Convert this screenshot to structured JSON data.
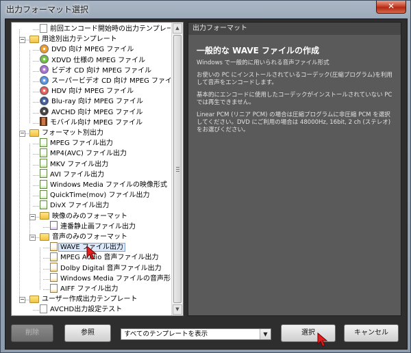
{
  "window": {
    "title": "出力フォーマット選択",
    "close_glyph": "✕"
  },
  "tree": {
    "items": [
      {
        "label": "前回エンコード開始時の出力テンプレート",
        "icon": "file-icon"
      },
      {
        "label": "用途別出力テンプレート",
        "icon": "folder-icon",
        "expander": "−"
      },
      {
        "label": "DVD 向け MPEG ファイル",
        "icon": "dvd-disc-icon"
      },
      {
        "label": "XDVD 仕様の MPEG ファイル",
        "icon": "xdvd-disc-icon"
      },
      {
        "label": "ビデオ CD 向け MPEG ファイル",
        "icon": "vcd-disc-icon"
      },
      {
        "label": "スーパービデオ CD 向け MPEG ファイル",
        "icon": "svcd-disc-icon"
      },
      {
        "label": "HDV 向け MPEG ファイル",
        "icon": "hdv-disc-icon"
      },
      {
        "label": "Blu-ray 向け MPEG ファイル",
        "icon": "bluray-disc-icon"
      },
      {
        "label": "AVCHD 向け MPEG ファイル",
        "icon": "avchd-disc-icon"
      },
      {
        "label": "モバイル向け MPEG ファイル",
        "icon": "mobile-icon"
      },
      {
        "label": "フォーマット別出力",
        "icon": "folder-icon",
        "expander": "−"
      },
      {
        "label": "MPEG ファイル出力",
        "icon": "video-file-icon"
      },
      {
        "label": "MP4(AVC) ファイル出力",
        "icon": "video-file-icon"
      },
      {
        "label": "MKV ファイル出力",
        "icon": "video-file-icon"
      },
      {
        "label": "AVI ファイル出力",
        "icon": "video-file-icon"
      },
      {
        "label": "Windows Media ファイルの映像形式",
        "icon": "video-file-icon"
      },
      {
        "label": "QuickTime(mov) ファイル出力",
        "icon": "video-file-icon"
      },
      {
        "label": "DivX ファイル出力",
        "icon": "video-file-icon"
      },
      {
        "label": "映像のみのフォーマット",
        "icon": "folder-icon",
        "expander": "−"
      },
      {
        "label": "連番静止画ファイル出力",
        "icon": "image-file-icon"
      },
      {
        "label": "音声のみのフォーマット",
        "icon": "folder-icon",
        "expander": "−"
      },
      {
        "label": "WAVE ファイル出力",
        "icon": "audio-file-icon",
        "selected": true
      },
      {
        "label": "MPEG Audio 音声ファイル出力",
        "icon": "audio-file-icon"
      },
      {
        "label": "Dolby Digital 音声ファイル出力",
        "icon": "audio-file-icon"
      },
      {
        "label": "Windows Media ファイルの音声形式",
        "icon": "audio-file-icon"
      },
      {
        "label": "AIFF ファイル出力",
        "icon": "audio-file-icon"
      },
      {
        "label": "ユーザー作成出力テンプレート",
        "icon": "folder-icon",
        "expander": "−"
      },
      {
        "label": "AVCHD出力設定テスト",
        "icon": "file-icon"
      }
    ]
  },
  "description": {
    "header": "出力フォーマット",
    "title": "一般的な WAVE ファイルの作成",
    "paragraphs": [
      "Windows で一般的に用いられる音声ファイル形式",
      "お使いの PC にインストールされているコーデック(圧縮プログラム)を利用して音声をエンコードします。",
      "基本的にエンコードに使用したコーデックがインストールされていない PC では再生できません。",
      "Linear PCM (リニア PCM) の場合は圧縮プログラムに非圧縮 PCM を選択してください。DVD にご利用の場合は 48000Hz, 16bit, 2 ch (ステレオ) をお選びください。"
    ]
  },
  "buttons": {
    "delete": "削除",
    "reference": "参照",
    "select": "選択",
    "cancel": "キャンセル"
  },
  "template_filter": {
    "value": "すべてのテンプレートを表示"
  },
  "colors": {
    "accent_selected": "#dbe9fa",
    "panel_bg": "#5a5a5a",
    "cursor": "#e02020"
  }
}
